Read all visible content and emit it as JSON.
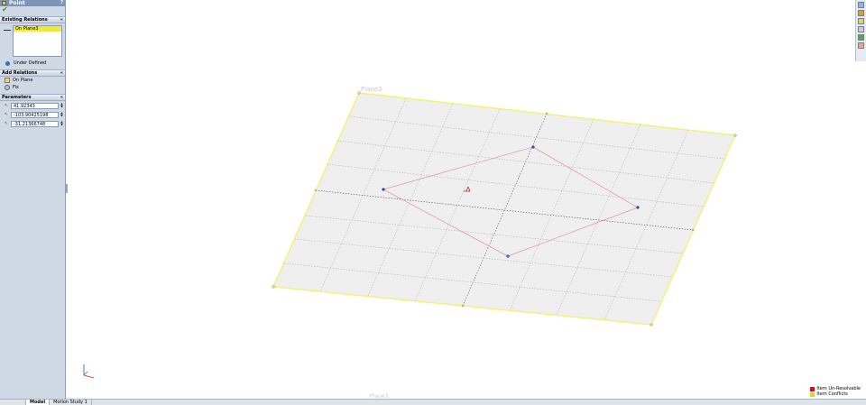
{
  "property_manager": {
    "title": "Point",
    "existing_relations": {
      "header": "Existing Relations",
      "items": [
        "On Plane3"
      ],
      "status": "Under Defined"
    },
    "add_relations": {
      "header": "Add Relations",
      "items": [
        {
          "label": "On Plane",
          "icon": "on-plane-icon"
        },
        {
          "label": "Fix",
          "icon": "fix-icon"
        }
      ]
    },
    "parameters": {
      "header": "Parameters",
      "fields": [
        {
          "axis": "x",
          "value": "41.92343"
        },
        {
          "axis": "y",
          "value": "-103.90425198"
        },
        {
          "axis": "z",
          "value": "-31.21366748"
        }
      ]
    }
  },
  "viewport": {
    "plane_label": "Plane3",
    "bottom_label": "Plane3"
  },
  "legend": {
    "items": [
      {
        "label": "Item Un-Resolvable",
        "color": "#cc1111"
      },
      {
        "label": "Item Conflicts",
        "color": "#e8d21a"
      }
    ]
  },
  "tabs": [
    "",
    "Model",
    "Motion Study 1"
  ],
  "colors": {
    "plane_border": "#f2f27a",
    "grid": "#a8a8a8",
    "sketch": "#e59aa8",
    "point": "#2a48a8",
    "origin": "#cc2222"
  }
}
